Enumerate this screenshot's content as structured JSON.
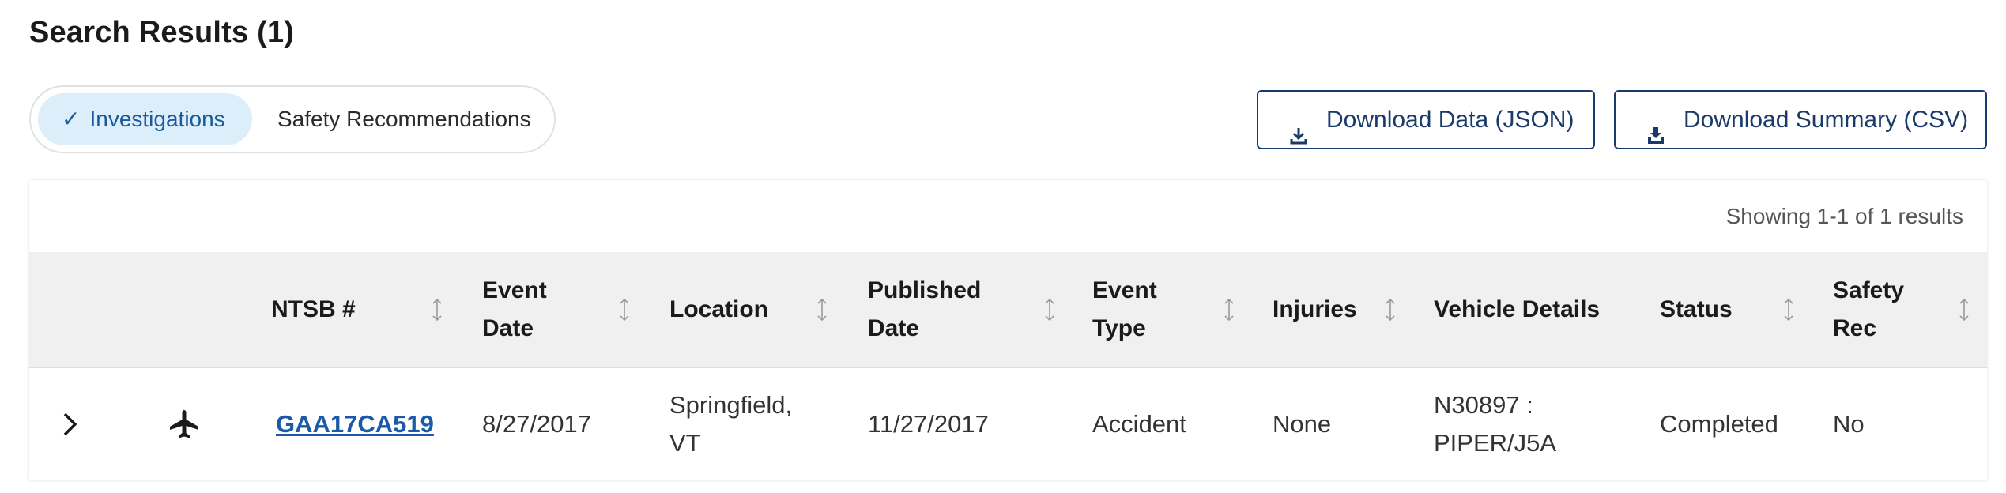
{
  "page": {
    "title": "Search Results (1)"
  },
  "toggle": {
    "investigations_check": "✓",
    "investigations_label": "Investigations",
    "safety_recommendations_label": "Safety Recommendations"
  },
  "actions": {
    "download_json_label": "Download Data (JSON)",
    "download_csv_label": "Download Summary (CSV)"
  },
  "results": {
    "showing": "Showing 1-1 of 1 results",
    "columns": [
      {
        "line1": "NTSB #",
        "line2": ""
      },
      {
        "line1": "Event",
        "line2": "Date"
      },
      {
        "line1": "Location",
        "line2": ""
      },
      {
        "line1": "Published",
        "line2": "Date"
      },
      {
        "line1": "Event",
        "line2": "Type"
      },
      {
        "line1": "Injuries",
        "line2": ""
      },
      {
        "line1": "Vehicle Details",
        "line2": ""
      },
      {
        "line1": "Status",
        "line2": ""
      },
      {
        "line1": "Safety",
        "line2": "Rec"
      }
    ],
    "rows": [
      {
        "ntsb": "GAA17CA519",
        "event_date": "8/27/2017",
        "location_line1": "Springfield,",
        "location_line2": "VT",
        "published_date": "11/27/2017",
        "event_type": "Accident",
        "injuries": "None",
        "vehicle_line1": "N30897 :",
        "vehicle_line2": "PIPER/J5A",
        "status": "Completed",
        "safety_rec": "No"
      }
    ]
  },
  "icons": {
    "expand": "chevron-right-icon",
    "mode": "airplane-icon",
    "sort": "sort-icon",
    "download": "download-icon",
    "download_stack": "download-stack-icon"
  },
  "colors": {
    "accent": "#1a3a6b",
    "link": "#1a5aa8",
    "toggle_active_bg": "#ddeefb",
    "header_bg": "#f0f0f0"
  }
}
